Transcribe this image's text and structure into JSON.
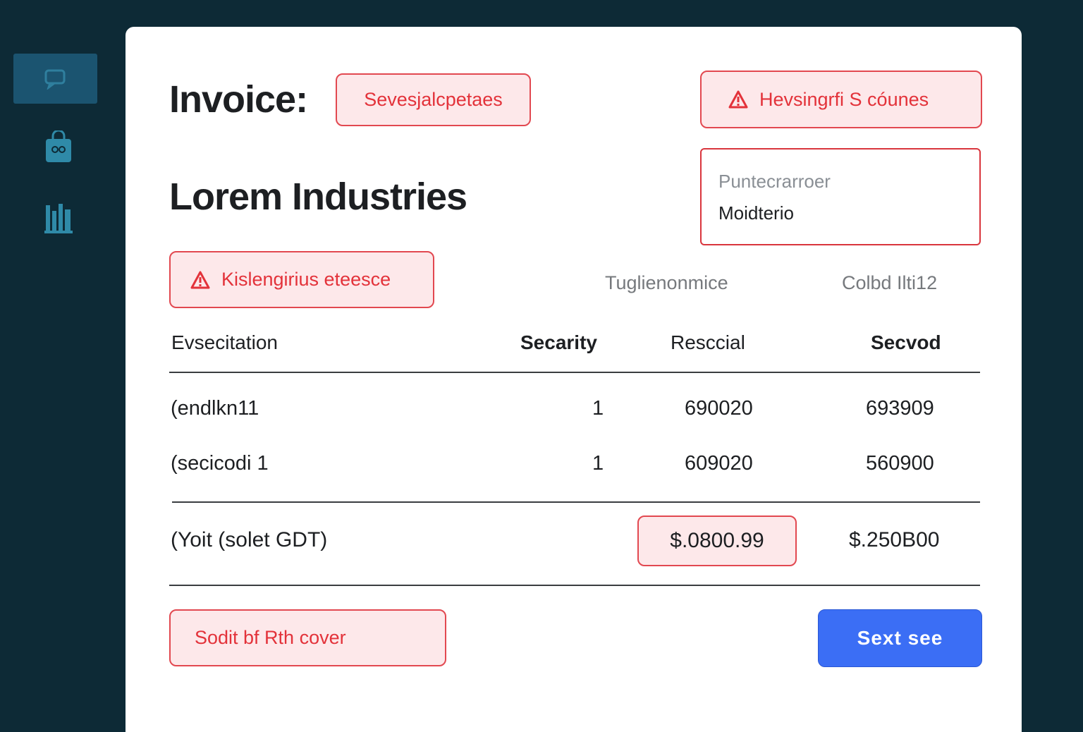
{
  "sidebar": {
    "items": [
      {
        "icon": "chat-icon",
        "active": true
      },
      {
        "icon": "bag-icon",
        "active": false
      },
      {
        "icon": "bar-chart-icon",
        "active": false
      }
    ]
  },
  "header": {
    "title": "Invoice:",
    "company": "Lorem Industries"
  },
  "errors": {
    "title_chip": "Sevesjalcpetaes",
    "top_right": "Hevsingrfi S cóunes",
    "company_chip": "Kislengirius eteesce",
    "bottom": "Sodit bf Rth cover"
  },
  "field": {
    "placeholder": "Puntecrarroer",
    "value": "Moidterio"
  },
  "meta": {
    "left": "Tuglienonmice",
    "right": "Colbd Ilti12"
  },
  "table": {
    "headers": [
      "Evsecitation",
      "Secarity",
      "Resccial",
      "Secvod"
    ],
    "rows": [
      [
        "(endlkn11",
        "1",
        "690020",
        "693909"
      ],
      [
        "(secicodi 1",
        "1",
        "609020",
        "560900"
      ]
    ],
    "total_label": "(Yoit (solet GDT)",
    "total_value": "$.0800.99",
    "grand_total": "$.250B00"
  },
  "actions": {
    "primary_label": "Sext see"
  },
  "colors": {
    "background": "#0d2a36",
    "accent": "#3b6ef5",
    "error": "#e3323a",
    "error_bg": "#fde8ea"
  }
}
